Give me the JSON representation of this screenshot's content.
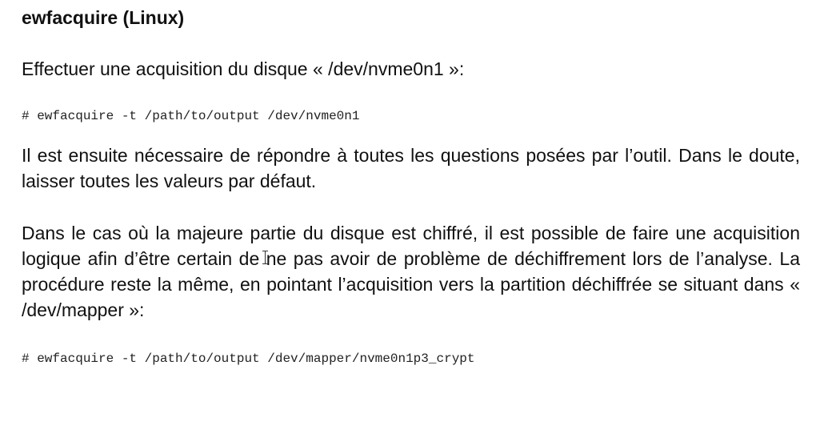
{
  "document": {
    "heading": "ewfacquire (Linux)",
    "intro": "Effectuer une acquisition du disque « /dev/nvme0n1 »:",
    "command_1": "# ewfacquire -t /path/to/output /dev/nvme0n1",
    "paragraph_2": "Il est ensuite nécessaire de répondre à toutes les questions posées par l’outil. Dans le doute, laisser toutes les valeurs par défaut.",
    "paragraph_3": "Dans le cas où la majeure partie du disque est chiffré, il est possible de faire une acquisition logique afin d’être certain de ne pas avoir de problème de déchiffrement lors de l’analyse. La procédure reste la même, en pointant l’acquisition vers la partition déchiffrée se situant dans « /dev/mapper »:",
    "command_2": "# ewfacquire -t /path/to/output /dev/mapper/nvme0n1p3_crypt"
  }
}
